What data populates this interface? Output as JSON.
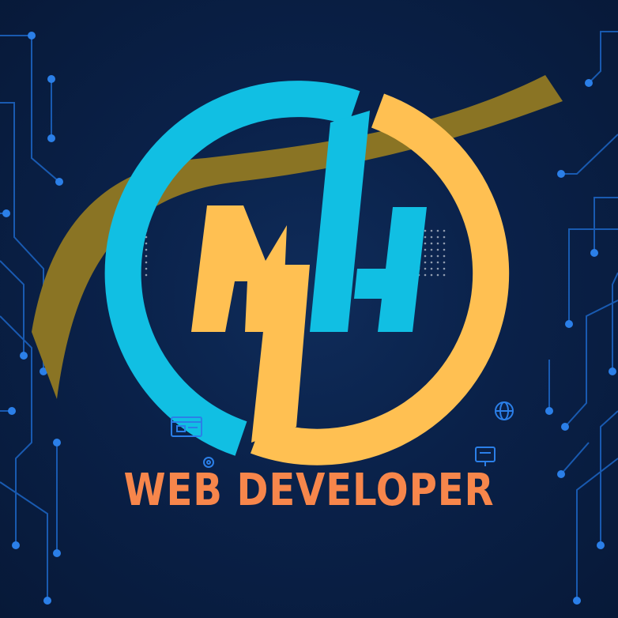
{
  "logo": {
    "letters": "MH",
    "tagline": "WEB DEVELOPER"
  },
  "colors": {
    "background": "#0a2149",
    "circuit": "#1f6fd6",
    "cyan": "#11bfe3",
    "yellow": "#ffc052",
    "swoosh": "#8a7424",
    "tagline": "#f7864b"
  },
  "icons": [
    "browser-icon",
    "globe-icon",
    "gear-icon",
    "monitor-icon"
  ]
}
